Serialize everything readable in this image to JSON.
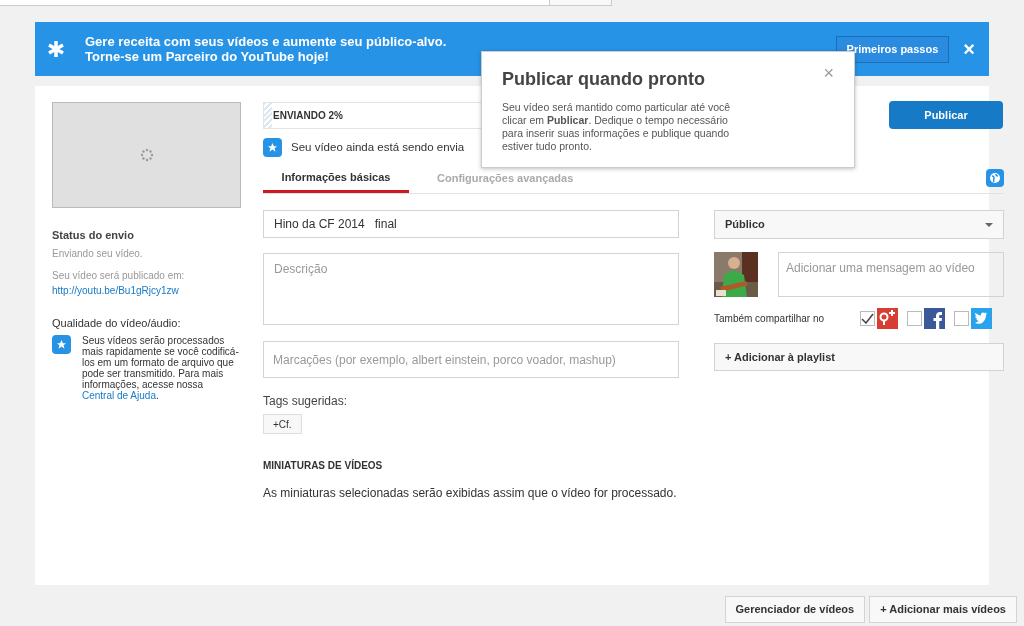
{
  "banner": {
    "lines": [
      "Gere receita com seus vídeos e aumente seu público-alvo.",
      "Torne-se um Parceiro do YouTube hoje!"
    ],
    "button": "Primeiros passos",
    "close": "×"
  },
  "upload": {
    "progress_label": "ENVIANDO 2%",
    "level": 0.02,
    "notice": "Seu vídeo ainda está sendo envia"
  },
  "sidebar": {
    "status_title": "Status do envio",
    "status_text": "Enviando seu vídeo.",
    "publish_label": "Seu vídeo será publicado em:",
    "link": "http://youtu.be/Bu1gRjcy1zw",
    "quality_title": "Qualidade do vídeo/áudio:",
    "quality_text": "Seus vídeos serão processados mais rapidamente se você codificá-los em um formato de arquivo que pode ser transmitido. Para mais informações, acesse nossa",
    "help_link": "Central de Ajuda",
    "help_end": "."
  },
  "tabs": [
    {
      "label": "Informações básicas",
      "selected": true
    },
    {
      "label": "Configurações avançadas",
      "selected": false
    }
  ],
  "form": {
    "title": "Hino da CF 2014   final",
    "description_placeholder": "Descrição",
    "tags_placeholder": "Marcações (por exemplo, albert einstein, porco voador, mashup)",
    "suggested_label": "Tags sugeridas:",
    "suggested_tags": [
      "+Cf."
    ],
    "thumbs_heading": "MINIATURAS DE VÍDEOS",
    "thumbs_text": "As miniaturas selecionadas serão exibidas assim que o vídeo for processado."
  },
  "publish_button": "Publicar",
  "privacy": "Público",
  "message_placeholder": "Adicionar uma mensagem ao vídeo",
  "share": {
    "label": "Também compartilhar no",
    "networks": [
      {
        "kind": "gplus",
        "checked": true
      },
      {
        "kind": "facebook",
        "checked": false
      },
      {
        "kind": "twitter",
        "checked": false
      }
    ]
  },
  "playlist_button": "+ Adicionar à playlist",
  "popover": {
    "title": "Publicar quando pronto",
    "text": "Seu vídeo será mantido como particular até você clicar em **Publicar**. Dedique o tempo necessário para inserir suas informações e publique quando estiver tudo pronto.",
    "close": "×"
  },
  "footer_buttons": [
    "Gerenciador de vídeos",
    "+ Adicionar mais vídeos"
  ]
}
